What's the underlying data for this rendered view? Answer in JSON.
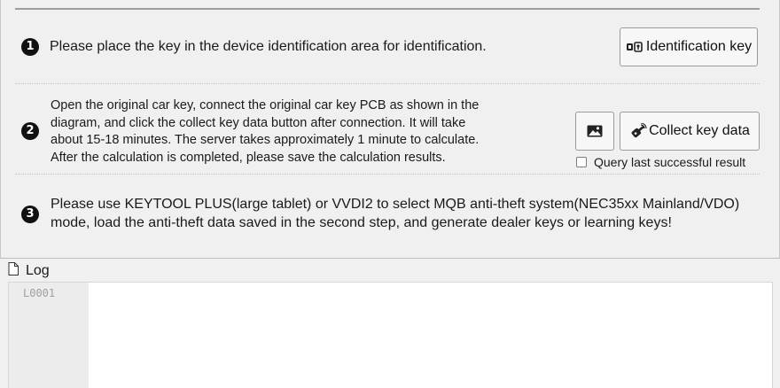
{
  "steps": [
    {
      "number": "1",
      "text": "Please place the key in the device identification area for identification.",
      "button_label": "Identification key",
      "button_icon": "key-reader-icon"
    },
    {
      "number": "2",
      "text_lines": [
        "Open the original car key, connect the original car key PCB as shown in the",
        "diagram, and click the collect key data button after connection. It will take",
        "about 15-18 minutes. The server takes approximately 1 minute to calculate.",
        "After the calculation is completed, please save the calculation results."
      ],
      "image_button_icon": "image-icon",
      "button_label": "Collect key data",
      "button_icon": "key-fob-icon",
      "checkbox_label": "Query last successful result",
      "checkbox_checked": false
    },
    {
      "number": "3",
      "text_lines": [
        "Please use KEYTOOL PLUS(large tablet) or VVDI2 to select MQB anti-theft system(NEC35xx Mainland/VDO)",
        "mode, load the anti-theft data saved in the second step, and generate dealer keys or learning keys!"
      ]
    }
  ],
  "log": {
    "title": "Log",
    "icon": "document-icon",
    "line_numbers": [
      "L0001"
    ]
  }
}
